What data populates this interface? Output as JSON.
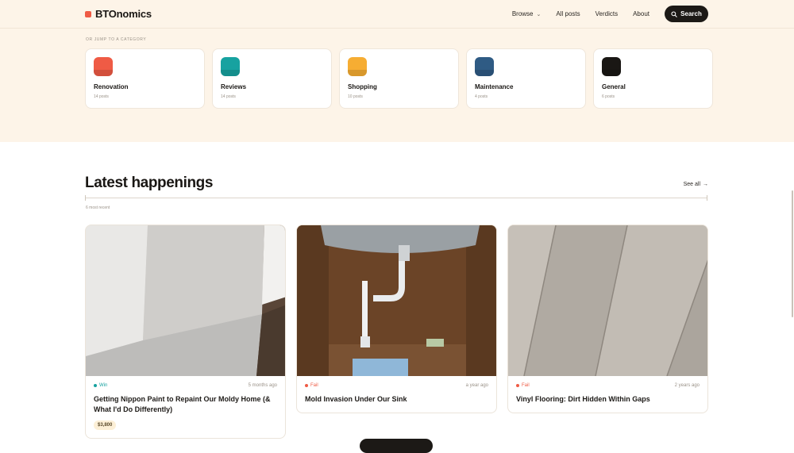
{
  "brand": {
    "name": "BTOnomics",
    "color": "#ef5b45"
  },
  "nav": {
    "browse": "Browse",
    "all_posts": "All posts",
    "verdicts": "Verdicts",
    "about": "About",
    "search": "Search"
  },
  "categories_section": {
    "label": "OR JUMP TO A CATEGORY",
    "items": [
      {
        "name": "Renovation",
        "count": "14 posts",
        "color": "#ef5b45"
      },
      {
        "name": "Reviews",
        "count": "14 posts",
        "color": "#17a2a0"
      },
      {
        "name": "Shopping",
        "count": "10 posts",
        "color": "#f6ad33"
      },
      {
        "name": "Maintenance",
        "count": "4 posts",
        "color": "#2f5b84"
      },
      {
        "name": "General",
        "count": "6 posts",
        "color": "#1a1714"
      }
    ]
  },
  "latest": {
    "title": "Latest happenings",
    "see_all": "See all",
    "subtitle": "6 most recent",
    "posts": [
      {
        "verdict": "Win",
        "verdict_color": "#17a2a0",
        "time": "5 months ago",
        "title": "Getting Nippon Paint to Repaint Our Moldy Home (& What I'd Do Differently)",
        "price": "$3,800",
        "image": "painted-wall-photo"
      },
      {
        "verdict": "Fail",
        "verdict_color": "#ef5b45",
        "time": "a year ago",
        "title": "Mold Invasion Under Our Sink",
        "price": "",
        "image": "under-sink-cabinet-photo"
      },
      {
        "verdict": "Fail",
        "verdict_color": "#ef5b45",
        "time": "2 years ago",
        "title": "Vinyl Flooring: Dirt Hidden Within Gaps",
        "price": "",
        "image": "vinyl-floor-photo"
      }
    ]
  }
}
